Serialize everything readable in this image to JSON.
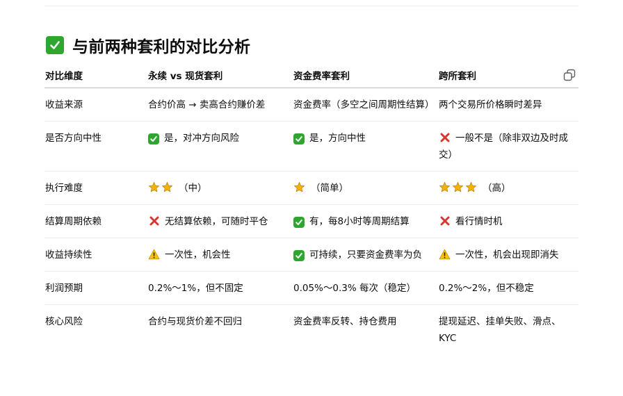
{
  "heading": {
    "icon": "check-mark-icon",
    "text": "与前两种套利的对比分析"
  },
  "copy_button": {
    "icon": "copy-icon"
  },
  "table": {
    "headers": [
      "对比维度",
      "永续 vs 现货套利",
      "资金费率套利",
      "跨所套利"
    ],
    "rows": [
      {
        "dimension": "收益来源",
        "cells": [
          {
            "mark": "",
            "stars": 0,
            "text": "合约价高 → 卖高合约赚价差"
          },
          {
            "mark": "",
            "stars": 0,
            "text": "资金费率（多空之间周期性结算）"
          },
          {
            "mark": "",
            "stars": 0,
            "text": "两个交易所价格瞬时差异"
          }
        ]
      },
      {
        "dimension": "是否方向中性",
        "cells": [
          {
            "mark": "check",
            "stars": 0,
            "text": "是，对冲方向风险"
          },
          {
            "mark": "check",
            "stars": 0,
            "text": "是，方向中性"
          },
          {
            "mark": "cross",
            "stars": 0,
            "text": "一般不是（除非双边及时成交）"
          }
        ]
      },
      {
        "dimension": "执行难度",
        "cells": [
          {
            "mark": "",
            "stars": 2,
            "text": "（中）"
          },
          {
            "mark": "",
            "stars": 1,
            "text": "（简单）"
          },
          {
            "mark": "",
            "stars": 3,
            "text": "（高）"
          }
        ]
      },
      {
        "dimension": "结算周期依赖",
        "cells": [
          {
            "mark": "cross",
            "stars": 0,
            "text": "无结算依赖，可随时平仓"
          },
          {
            "mark": "check",
            "stars": 0,
            "text": "有，每8小时等周期结算"
          },
          {
            "mark": "cross",
            "stars": 0,
            "text": "看行情时机"
          }
        ]
      },
      {
        "dimension": "收益持续性",
        "cells": [
          {
            "mark": "warn",
            "stars": 0,
            "text": "一次性，机会性"
          },
          {
            "mark": "check",
            "stars": 0,
            "text": "可持续，只要资金费率为负"
          },
          {
            "mark": "warn",
            "stars": 0,
            "text": "一次性，机会出现即消失"
          }
        ]
      },
      {
        "dimension": "利润预期",
        "cells": [
          {
            "mark": "",
            "stars": 0,
            "text": "0.2%～1%，但不固定"
          },
          {
            "mark": "",
            "stars": 0,
            "text": "0.05%～0.3% 每次（稳定）"
          },
          {
            "mark": "",
            "stars": 0,
            "text": "0.2%～2%，但不稳定"
          }
        ]
      },
      {
        "dimension": "核心风险",
        "cells": [
          {
            "mark": "",
            "stars": 0,
            "text": "合约与现货价差不回归"
          },
          {
            "mark": "",
            "stars": 0,
            "text": "资金费率反转、持仓费用"
          },
          {
            "mark": "",
            "stars": 0,
            "text": "提现延迟、挂单失败、滑点、KYC"
          }
        ]
      }
    ]
  },
  "colors": {
    "check_green": "#2fa62f",
    "cross_red": "#d6362f",
    "star_gold": "#f5b301",
    "warn_yellow": "#f7c500"
  }
}
